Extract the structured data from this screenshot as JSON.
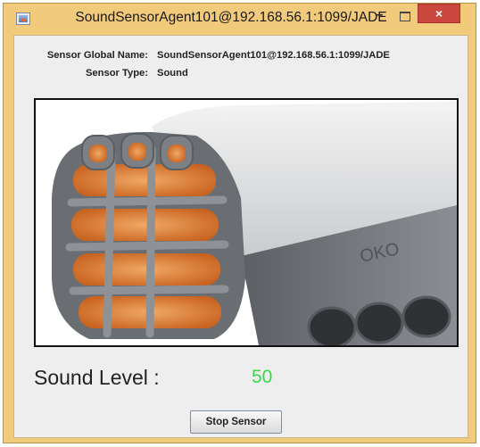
{
  "window": {
    "title": "SoundSensorAgent101@192.168.56.1:1099/JADE",
    "minimize_glyph": "–",
    "close_glyph": "×"
  },
  "info": {
    "global_name_label": "Sensor Global Name:",
    "global_name_value": "SoundSensorAgent101@192.168.56.1:1099/JADE",
    "type_label": "Sensor Type:",
    "type_value": "Sound"
  },
  "image": {
    "icon": "sound-sensor-photo"
  },
  "reading": {
    "label": "Sound Level :",
    "value": "50",
    "value_color": "#39d84a"
  },
  "controls": {
    "stop_label": "Stop Sensor"
  }
}
